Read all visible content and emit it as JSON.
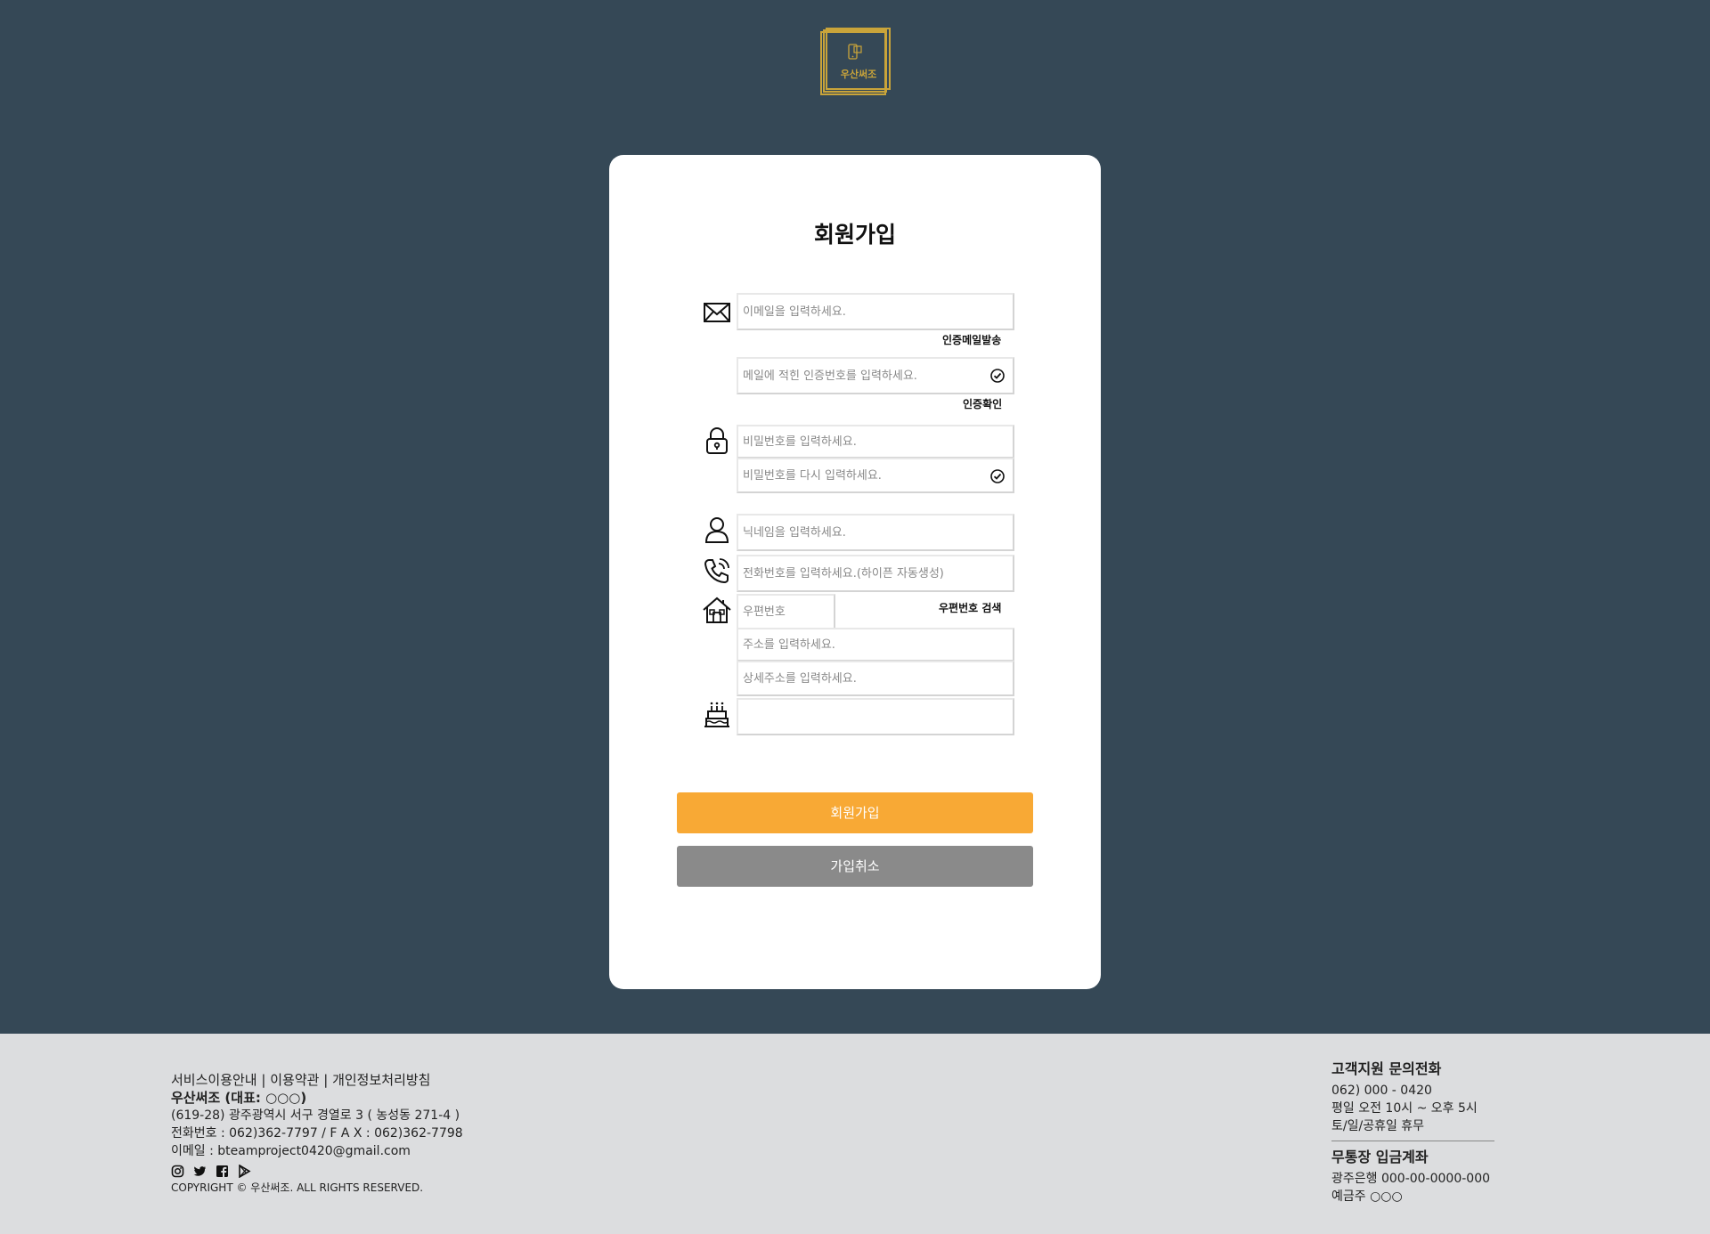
{
  "brand": {
    "logo_text": "우산써조"
  },
  "signup": {
    "title": "회원가입",
    "email_placeholder": "이메일을 입력하세요.",
    "send_mail_label": "인증메일발송",
    "code_placeholder": "메일에 적힌 인증번호를 입력하세요.",
    "verify_label": "인증확인",
    "password_placeholder": "비밀번호를 입력하세요.",
    "password_confirm_placeholder": "비밀번호를 다시 입력하세요.",
    "nickname_placeholder": "닉네임을 입력하세요.",
    "phone_placeholder": "전화번호를 입력하세요.(하이픈 자동생성)",
    "zipcode_placeholder": "우편번호",
    "zipcode_search_label": "우편번호 검색",
    "address_placeholder": "주소를 입력하세요.",
    "address_detail_placeholder": "상세주소를 입력하세요.",
    "birthday_value": "",
    "join_button": "회원가입",
    "cancel_button": "가입취소"
  },
  "icons": {
    "email": "envelope-icon",
    "password": "lock-icon",
    "nickname": "user-icon",
    "phone": "phone-icon",
    "address": "home-icon",
    "birthday": "cake-icon",
    "verified": "check-circle-icon"
  },
  "colors": {
    "background": "#354856",
    "accent": "#f8a935",
    "logo": "#c9a43a",
    "cancel": "#8a8a8a",
    "footer": "#dcdddf"
  },
  "footer": {
    "link_service": "서비스이용안내",
    "link_terms": "이용약관",
    "link_privacy": "개인정보처리방침",
    "separator": "|",
    "company": "우산써조 (대표: ○○○)",
    "address": "(619-28) 광주광역시 서구 경열로 3 ( 농성동 271-4 )",
    "phone_fax": "전화번호 : 062)362-7797 / F A X : 062)362-7798",
    "email": "이메일 : bteamproject0420@gmail.com",
    "copyright": "COPYRIGHT © 우산써조. ALL RIGHTS RESERVED.",
    "support_title": "고객지원 문의전화",
    "support_phone": "062) 000 - 0420",
    "support_hours": "평일 오전 10시 ~ 오후 5시",
    "support_holiday": "토/일/공휴일 휴무",
    "bank_title": "무통장 입금계좌",
    "bank_account": "광주은행 000-00-0000-000",
    "bank_holder": "예금주 ○○○"
  }
}
